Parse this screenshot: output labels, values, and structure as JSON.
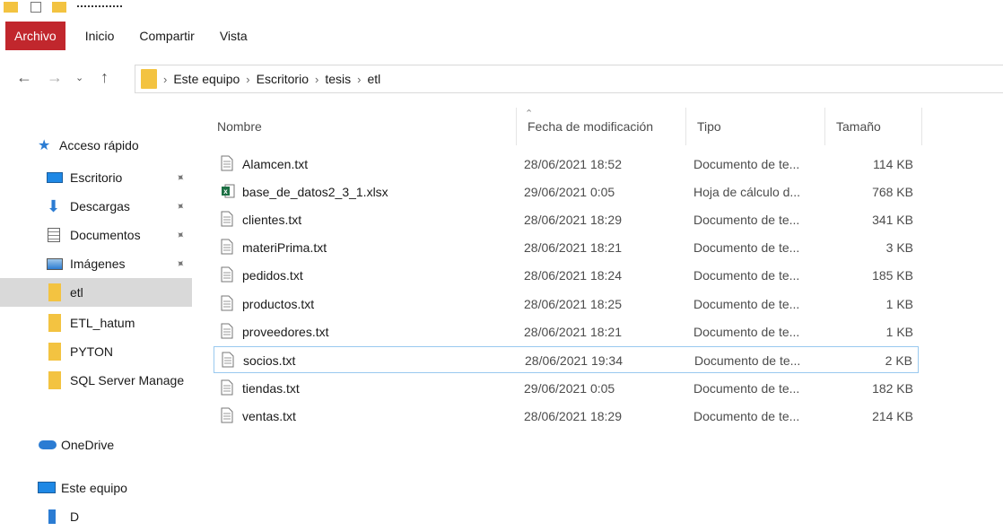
{
  "ribbon": {
    "tabs": [
      "Archivo",
      "Inicio",
      "Compartir",
      "Vista"
    ]
  },
  "breadcrumb": [
    "Este equipo",
    "Escritorio",
    "tesis",
    "etl"
  ],
  "columns": {
    "name": "Nombre",
    "date": "Fecha de modificación",
    "type": "Tipo",
    "size": "Tamaño"
  },
  "sidebar": {
    "quick_access": "Acceso rápido",
    "items": [
      {
        "label": "Escritorio",
        "icon": "desktop-icon",
        "pinned": true
      },
      {
        "label": "Descargas",
        "icon": "download-icon",
        "pinned": true
      },
      {
        "label": "Documentos",
        "icon": "documents-icon",
        "pinned": true
      },
      {
        "label": "Imágenes",
        "icon": "pictures-icon",
        "pinned": true
      },
      {
        "label": "etl",
        "icon": "folder-icon",
        "pinned": false,
        "selected": true
      },
      {
        "label": "ETL_hatum",
        "icon": "folder-icon",
        "pinned": false
      },
      {
        "label": "PYTON",
        "icon": "folder-icon",
        "pinned": false
      },
      {
        "label": "SQL Server Manage",
        "icon": "folder-icon",
        "pinned": false
      }
    ],
    "onedrive": "OneDrive",
    "this_pc": "Este equipo",
    "partial_next": "D"
  },
  "files": [
    {
      "name": "Alamcen.txt",
      "date": "28/06/2021 18:52",
      "type": "Documento de te...",
      "size": "114 KB",
      "icon": "text-file-icon"
    },
    {
      "name": "base_de_datos2_3_1.xlsx",
      "date": "29/06/2021 0:05",
      "type": "Hoja de cálculo d...",
      "size": "768 KB",
      "icon": "excel-file-icon"
    },
    {
      "name": "clientes.txt",
      "date": "28/06/2021 18:29",
      "type": "Documento de te...",
      "size": "341 KB",
      "icon": "text-file-icon"
    },
    {
      "name": "materiPrima.txt",
      "date": "28/06/2021 18:21",
      "type": "Documento de te...",
      "size": "3 KB",
      "icon": "text-file-icon"
    },
    {
      "name": "pedidos.txt",
      "date": "28/06/2021 18:24",
      "type": "Documento de te...",
      "size": "185 KB",
      "icon": "text-file-icon"
    },
    {
      "name": "productos.txt",
      "date": "28/06/2021 18:25",
      "type": "Documento de te...",
      "size": "1 KB",
      "icon": "text-file-icon"
    },
    {
      "name": "proveedores.txt",
      "date": "28/06/2021 18:21",
      "type": "Documento de te...",
      "size": "1 KB",
      "icon": "text-file-icon"
    },
    {
      "name": "socios.txt",
      "date": "28/06/2021 19:34",
      "type": "Documento de te...",
      "size": "2 KB",
      "icon": "text-file-icon",
      "focused": true
    },
    {
      "name": "tiendas.txt",
      "date": "29/06/2021 0:05",
      "type": "Documento de te...",
      "size": "182 KB",
      "icon": "text-file-icon"
    },
    {
      "name": "ventas.txt",
      "date": "28/06/2021 18:29",
      "type": "Documento de te...",
      "size": "214 KB",
      "icon": "text-file-icon"
    }
  ],
  "colors": {
    "accent": "#c1272d",
    "folder": "#f3c341",
    "selection": "#d9d9d9",
    "focus_border": "#99c9ef"
  }
}
